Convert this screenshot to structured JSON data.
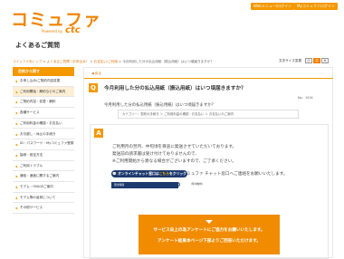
{
  "header": {
    "logo_text": "コミュファ",
    "logo_sub": "Powered by",
    "logo_ctc": "ctc",
    "btn_left": "Webメニュー/ログイン",
    "btn_right": "Myコミュファログイン"
  },
  "page_title": "よくあるご質問",
  "breadcrumb": {
    "home": "コミュファ光トップ",
    "sep": " > ",
    "cat1": "よくあるご質問（お申込み）",
    "cat2": "お支払い/ご利用",
    "current": "今月利用した分の払込用紙（振込用紙）はいつ頃届きますか？"
  },
  "font_size": {
    "label": "文字サイズ変更",
    "small": "小",
    "medium": "中",
    "large": "大"
  },
  "sidebar": {
    "heading": "目的から探す",
    "items": [
      "お申し込み/ご契約内容変更",
      "ご利用開始・解約などのご案内",
      "ご契約内容・変更・解約",
      "各種サービス",
      "ご利用料金の確認・お支払い",
      "お引越し・休止の手続き",
      "ID・パスワード・Myコミュファ登録",
      "接続・設定方法",
      "ご利用トラブル",
      "通信・速度に関するご案内",
      "モデム・ONUのご案内",
      "モデム等の返却について",
      "その他サービス"
    ]
  },
  "main": {
    "back": "戻る",
    "q_label": "Q",
    "question": "今月利用した分の払込用紙（振込用紙）はいつ頃届きますか？",
    "faq_no": "No：1934",
    "question_body": "今月利用した分の払込用紙（振込用紙）はいつ頃届きますか？",
    "category": "カテゴリー：契約の手続き ＞ ご利用料金の確認・お支払い ＞ お支払いのご案内",
    "a_label": "A",
    "answer_lines": [
      "ご利用月の翌月、中旬頃を目途に発送させていただいております。",
      "発送前の請求書は受け付けておりませんので、",
      "※ご利用開始から異なる場合がございますので、ご了承ください。",
      "月の下旬になっても届かない場合は、コミュファ チャット窓口へご連絡をお願いいたします。"
    ],
    "chat_btn_pre": "オンラインチャット窓口は",
    "chat_btn_hl": "こちら",
    "chat_btn_post": "をクリック",
    "hours_label": "受付時間",
    "hours_time": "9:00 ～ 20:00",
    "hours_note": "（年中無休）",
    "survey_line1": "サービス向上の為アンケートにご協力をお願いいたします。",
    "survey_line2": "アンケート結果本ページ下部よりご回答いただけます。"
  }
}
